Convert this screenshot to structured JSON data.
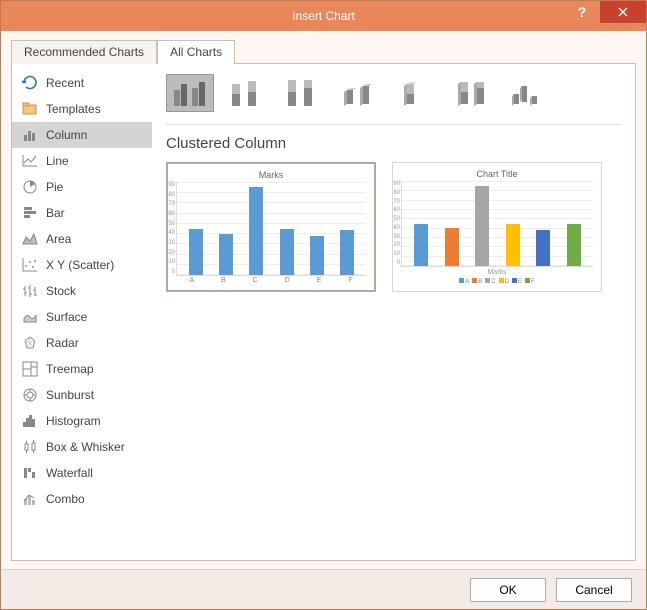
{
  "titlebar": {
    "title": "Insert Chart"
  },
  "tabs": [
    {
      "label": "Recommended Charts",
      "active": false
    },
    {
      "label": "All Charts",
      "active": true
    }
  ],
  "sidebar": {
    "items": [
      {
        "label": "Recent",
        "icon": "recent-icon"
      },
      {
        "label": "Templates",
        "icon": "templates-icon"
      },
      {
        "label": "Column",
        "icon": "column-icon",
        "selected": true
      },
      {
        "label": "Line",
        "icon": "line-icon"
      },
      {
        "label": "Pie",
        "icon": "pie-icon"
      },
      {
        "label": "Bar",
        "icon": "bar-icon"
      },
      {
        "label": "Area",
        "icon": "area-icon"
      },
      {
        "label": "X Y (Scatter)",
        "icon": "scatter-icon"
      },
      {
        "label": "Stock",
        "icon": "stock-icon"
      },
      {
        "label": "Surface",
        "icon": "surface-icon"
      },
      {
        "label": "Radar",
        "icon": "radar-icon"
      },
      {
        "label": "Treemap",
        "icon": "treemap-icon"
      },
      {
        "label": "Sunburst",
        "icon": "sunburst-icon"
      },
      {
        "label": "Histogram",
        "icon": "histogram-icon"
      },
      {
        "label": "Box & Whisker",
        "icon": "box-whisker-icon"
      },
      {
        "label": "Waterfall",
        "icon": "waterfall-icon"
      },
      {
        "label": "Combo",
        "icon": "combo-icon"
      }
    ]
  },
  "subtypes": [
    {
      "name": "clustered-column",
      "selected": true
    },
    {
      "name": "stacked-column"
    },
    {
      "name": "100-stacked-column"
    },
    {
      "name": "3d-clustered-column"
    },
    {
      "name": "3d-stacked-column"
    },
    {
      "name": "3d-100-stacked-column"
    },
    {
      "name": "3d-column"
    }
  ],
  "subtitle": "Clustered Column",
  "previews": [
    {
      "title": "Marks",
      "selected": true,
      "chart_ref": 0
    },
    {
      "title": "Chart Title",
      "axis_label": "Marks",
      "selected": false,
      "chart_ref": 1
    }
  ],
  "footer": {
    "ok": "OK",
    "cancel": "Cancel"
  },
  "chart_data": [
    {
      "type": "bar",
      "title": "Marks",
      "categories": [
        "A",
        "B",
        "C",
        "D",
        "E",
        "F"
      ],
      "values": [
        45,
        40,
        85,
        45,
        38,
        44
      ],
      "ylabel": "",
      "xlabel": "",
      "ylim": [
        0,
        90
      ],
      "yticks": [
        0,
        10,
        20,
        30,
        40,
        50,
        60,
        70,
        80,
        90
      ],
      "series_colors": [
        "#5b9bd5"
      ]
    },
    {
      "type": "bar",
      "title": "Chart Title",
      "categories": [
        "A",
        "B",
        "C",
        "D",
        "E",
        "F"
      ],
      "values": [
        45,
        40,
        85,
        45,
        38,
        44
      ],
      "ylabel": "",
      "xlabel": "Marks",
      "ylim": [
        0,
        90
      ],
      "yticks": [
        0,
        10,
        20,
        30,
        40,
        50,
        60,
        70,
        80,
        90
      ],
      "series_colors": [
        "#5b9bd5",
        "#ed7d31",
        "#a5a5a5",
        "#ffc000",
        "#4472c4",
        "#70ad47"
      ],
      "legend": [
        "A",
        "B",
        "C",
        "D",
        "E",
        "F"
      ]
    }
  ]
}
